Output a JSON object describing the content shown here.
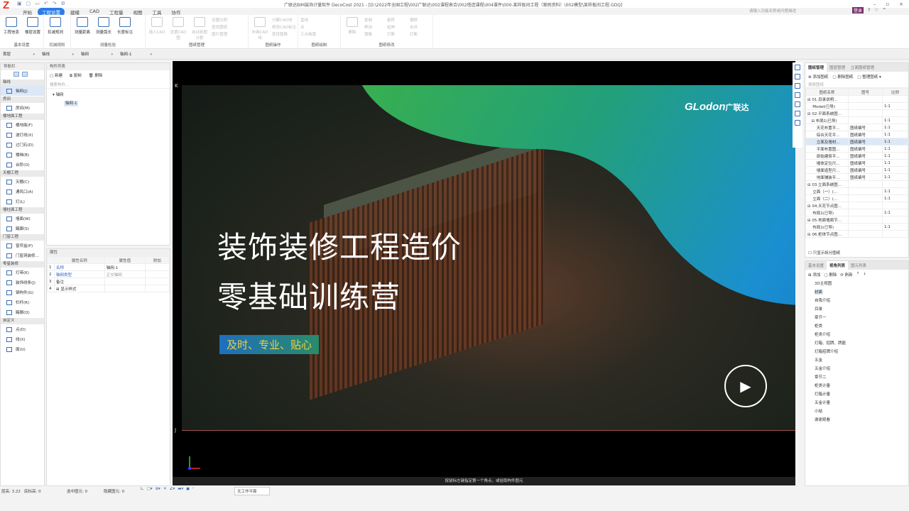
{
  "app": {
    "logo": "Z",
    "title": "广联达BIM装饰计量软件 DecoCost 2021 - [D:\\2022年全国工程\\002广联达\\002课程表合\\002塔造课程\\004课件\\000-某样板间工程（案例资料）\\002模型\\某样板间工程.GDQ]",
    "search_placeholder": "请输入功能名称或问题描述",
    "login": "登录",
    "help": "?",
    "win": [
      "–",
      "▫",
      "×"
    ]
  },
  "tabs": [
    "开始",
    "工程设置",
    "建模",
    "CAD",
    "工程量",
    "视图",
    "工具",
    "协作"
  ],
  "ribbon": {
    "groups": [
      {
        "label": "基本设置",
        "buttons": [
          "工程信息",
          "楼层设置"
        ]
      },
      {
        "label": "扣减规则",
        "buttons": [
          "扣减规则"
        ]
      },
      {
        "label": "测量检验",
        "buttons": [
          "测量距离",
          "测量弧长",
          "长度标注"
        ]
      },
      {
        "label": "图纸管理",
        "buttons": [
          "插入CAD",
          "设置CAD图",
          "自动拆图分割"
        ],
        "small": [
          "设置比例",
          "查找图纸",
          "图片管理"
        ]
      },
      {
        "label": "图纸操作",
        "buttons": [
          "补画CAD线"
        ],
        "small": [
          "分解CAD块",
          "修改CAD标注",
          "查找替换"
        ]
      },
      {
        "label": "图纸绘制",
        "small": [
          "直线",
          "点",
          "三点画弧"
        ]
      },
      {
        "label": "图纸修改",
        "buttons": [
          "删除"
        ],
        "small": [
          "复制",
          "移动",
          "镜像",
          "旋转",
          "延伸",
          "打断",
          "偏移",
          "合并",
          "打断"
        ]
      }
    ]
  },
  "dropdowns": [
    "首层",
    "轴线",
    "轴网",
    "轴网-1"
  ],
  "nav": {
    "title": "导航栏",
    "sections": [
      {
        "label": "轴线",
        "items": [
          {
            "label": "轴网(J)",
            "selected": true
          }
        ]
      },
      {
        "label": "房间",
        "items": [
          {
            "label": "房间(M)"
          }
        ]
      },
      {
        "label": "楼地面工程",
        "items": [
          {
            "label": "楼地面(F)"
          },
          {
            "label": "波打线(X)"
          },
          {
            "label": "过门石(D)"
          },
          {
            "label": "楼梯(B)"
          },
          {
            "label": "台阶(O)"
          }
        ]
      },
      {
        "label": "天棚工程",
        "items": [
          {
            "label": "天棚(C)"
          },
          {
            "label": "通风口(A)"
          },
          {
            "label": "灯(L)"
          }
        ]
      },
      {
        "label": "墙柱面工程",
        "items": [
          {
            "label": "墙面(W)"
          },
          {
            "label": "踢脚(S)"
          }
        ]
      },
      {
        "label": "门窗工程",
        "items": [
          {
            "label": "窗帘盒(P)"
          },
          {
            "label": "门窗洞装修..."
          }
        ]
      },
      {
        "label": "零星装修",
        "items": [
          {
            "label": "灯带(K)"
          },
          {
            "label": "装饰线条(J)"
          },
          {
            "label": "钢构件(G)"
          },
          {
            "label": "栏杆(R)"
          },
          {
            "label": "踢脚(Q)"
          }
        ]
      },
      {
        "label": "自定义",
        "items": [
          {
            "label": "点(D)"
          },
          {
            "label": "线(X)"
          },
          {
            "label": "面(U)"
          }
        ]
      }
    ]
  },
  "components": {
    "title": "构件列表",
    "new": "新建",
    "copy": "复制",
    "delete": "删除",
    "search_placeholder": "搜索构件...",
    "tree_root": "轴网",
    "tree_child": "轴网-1"
  },
  "properties": {
    "title": "属性",
    "headers": [
      "属性名称",
      "属性值",
      "附加"
    ],
    "rows": [
      {
        "n": "1",
        "name": "名称",
        "value": "轴网-1"
      },
      {
        "n": "2",
        "name": "轴网类型",
        "value": "正交轴网"
      },
      {
        "n": "3",
        "name": "备注",
        "value": ""
      },
      {
        "n": "4",
        "name": "⊞ 显示样式",
        "value": ""
      }
    ]
  },
  "video": {
    "logo": "GLodon",
    "logo_cn": "广联达",
    "title1": "装饰装修工程造价",
    "title2": "零基础训练营",
    "tagline": "及时、专业、贴心",
    "play": "▶"
  },
  "viewport": {
    "axis_k": "K",
    "axis_j": "J",
    "hint": "按鼠标左键指定第一个角点，或拾取构件图元"
  },
  "drawings": {
    "tabs": [
      "图纸管理",
      "图层管理",
      "立面图纸管理"
    ],
    "add": "添加图纸",
    "delete": "删除图纸",
    "organize": "整理图纸",
    "search_placeholder": "搜索图纸",
    "headers": [
      "图纸名称",
      "图号",
      "比例"
    ],
    "rows": [
      {
        "name": "⊟ 01.目录说明...",
        " no": "",
        "no": "",
        "scale": ""
      },
      {
        "name": "　 Model(已导)",
        "no": "",
        "scale": "1:1"
      },
      {
        "name": "⊟ 02.平面系统图...",
        "no": "",
        "scale": ""
      },
      {
        "name": "　⊟ 布局1(已导)",
        "no": "",
        "scale": "1:1"
      },
      {
        "name": "　　 天花布置平...",
        "no": "图纸编号",
        "scale": "1:1"
      },
      {
        "name": "　　 综合天花平...",
        "no": "图纸编号",
        "scale": "1:1"
      },
      {
        "name": "　　 立面及墙材...",
        "no": "图纸编号",
        "scale": "1:1",
        "selected": true
      },
      {
        "name": "　　 平面布置图...",
        "no": "图纸编号",
        "scale": "1:1"
      },
      {
        "name": "　　 原始建筑平...",
        "no": "图纸编号",
        "scale": "1:1"
      },
      {
        "name": "　　 墙体定位尺...",
        "no": "图纸编号",
        "scale": "1:1"
      },
      {
        "name": "　　 墙面造型尺...",
        "no": "图纸编号",
        "scale": "1:1"
      },
      {
        "name": "　　 地面铺装平...",
        "no": "图纸编号",
        "scale": "1:1"
      },
      {
        "name": "⊟ 03.立面系统图...",
        "no": "",
        "scale": ""
      },
      {
        "name": "　 立面（一）(...",
        "no": "",
        "scale": "1:1"
      },
      {
        "name": "　 立面（二）(...",
        "no": "",
        "scale": "1:1"
      },
      {
        "name": "⊟ 04.天花节点图...",
        "no": "",
        "scale": ""
      },
      {
        "name": "　 布局1(已导)",
        "no": "",
        "scale": "1:1"
      },
      {
        "name": "⊟ 05.地面墙面节...",
        "no": "",
        "scale": ""
      },
      {
        "name": "　 布局1(已导)",
        "no": "",
        "scale": "1:1"
      },
      {
        "name": "⊟ 06.柜体节点图...",
        "no": "",
        "scale": ""
      }
    ],
    "only_split": "只显示拆分图纸"
  },
  "views": {
    "tabs": [
      "基本设置",
      "视角列表",
      "图元列表"
    ],
    "add": "添加",
    "delete": "删除",
    "refresh": "刷新",
    "items": [
      "3D主视图",
      "封面",
      "自我介绍",
      "目录",
      "章节一",
      "柜类",
      "柜类介绍",
      "灯箱、招牌、牌匾",
      "灯箱招牌介绍",
      "五金",
      "五金介绍",
      "章节二",
      "柜类计量",
      "灯箱计量",
      "五金计量",
      "小结",
      "谢谢观看"
    ],
    "selected": 1
  },
  "status": {
    "floor_height": "层高: 3.22",
    "bottom_elev": "底标高: 0",
    "selected": "选中图元: 0",
    "hidden": "隐藏图元: 0",
    "workplane": "无工作平面"
  }
}
